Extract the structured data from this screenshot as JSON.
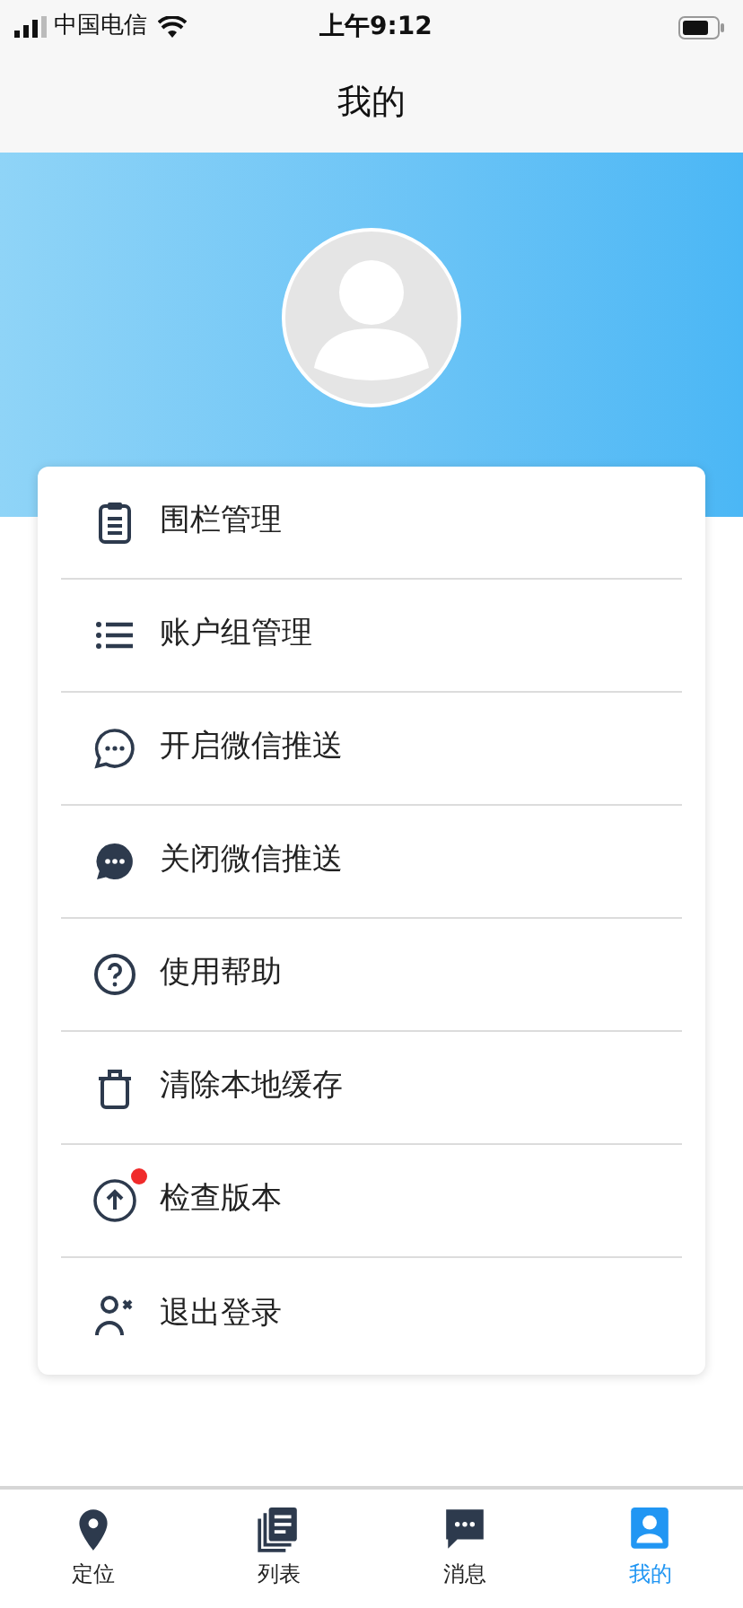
{
  "status_bar": {
    "carrier": "中国电信",
    "time": "上午9:12"
  },
  "nav_bar": {
    "title": "我的"
  },
  "menu": [
    {
      "kind": "clipboard",
      "label": "围栏管理",
      "badge": false
    },
    {
      "kind": "list",
      "label": "账户组管理",
      "badge": false
    },
    {
      "kind": "chat-outline",
      "label": "开启微信推送",
      "badge": false
    },
    {
      "kind": "chat-filled",
      "label": "关闭微信推送",
      "badge": false
    },
    {
      "kind": "help",
      "label": "使用帮助",
      "badge": false
    },
    {
      "kind": "trash",
      "label": "清除本地缓存",
      "badge": false
    },
    {
      "kind": "upgrade",
      "label": "检查版本",
      "badge": true
    },
    {
      "kind": "logout",
      "label": "退出登录",
      "badge": false
    }
  ],
  "tab_bar": [
    {
      "kind": "location",
      "label": "定位",
      "selected": false
    },
    {
      "kind": "list",
      "label": "列表",
      "selected": false
    },
    {
      "kind": "message",
      "label": "消息",
      "selected": false
    },
    {
      "kind": "profile",
      "label": "我的",
      "selected": true
    }
  ]
}
